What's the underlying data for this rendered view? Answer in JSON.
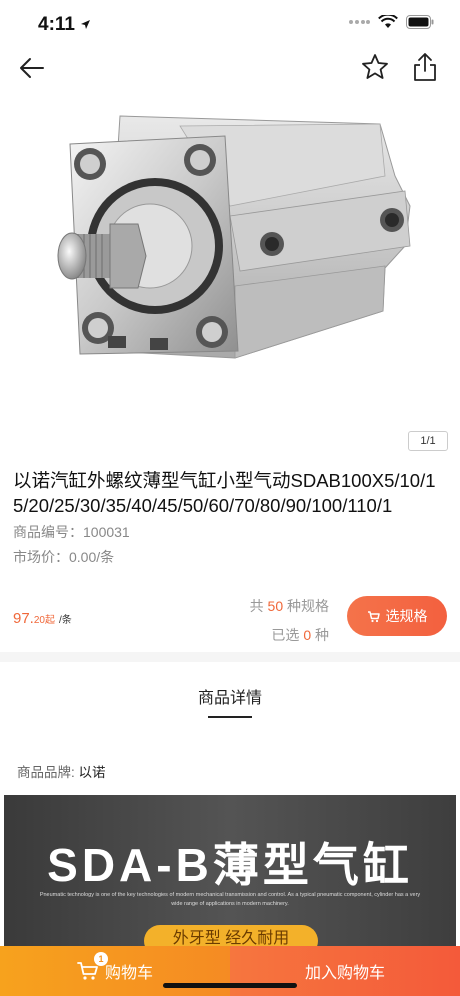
{
  "status": {
    "time": "4:11"
  },
  "product": {
    "image_counter": "1/1",
    "title": "以诺汽缸外螺纹薄型气缸小型气动SDAB100X5/10/15/20/25/30/35/40/45/50/60/70/80/90/100/110/1",
    "code_label": "商品编号：",
    "code_value": "100031",
    "market_label": "市场价：",
    "market_value": "0.00/条",
    "price_int": "97.",
    "price_dec": "20起",
    "price_unit": "/条",
    "spec_total_prefix": "共",
    "spec_total_num": "50",
    "spec_total_suffix": "种规格",
    "spec_selected_prefix": "已选",
    "spec_selected_num": "0",
    "spec_selected_suffix": "种",
    "choose_label": "选规格"
  },
  "detail": {
    "tab_label": "商品详情",
    "brand_label": "商品品牌: ",
    "brand_value": "以诺",
    "banner_title": "SDA-B薄型气缸",
    "banner_sub": "Pneumatic technology is one of the key technologies of modern mechanical transmission and control. As a typical pneumatic component, cylinder has a very wide range of applications in modern machinery.",
    "banner_pill": "外牙型 经久耐用"
  },
  "bottom": {
    "cart_label": "购物车",
    "cart_count": "1",
    "add_cart_label": "加入购物车"
  },
  "colors": {
    "accent": "#f0683a",
    "cart": "#f5931f"
  }
}
